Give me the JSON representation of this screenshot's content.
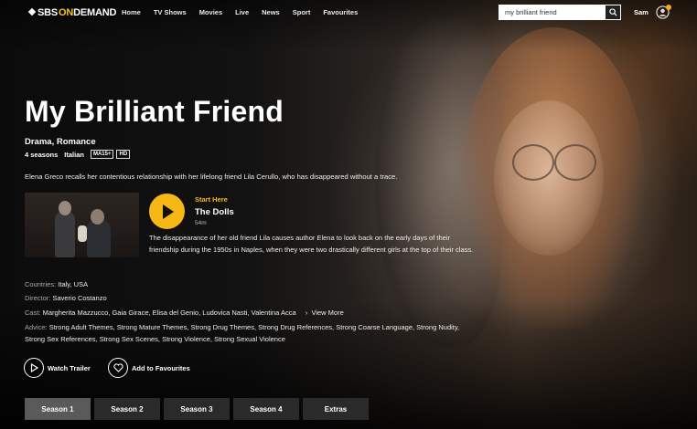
{
  "nav": {
    "logo": {
      "sbs": "SBS",
      "on": "ON",
      "demand": "DEMAND"
    },
    "links": [
      "Home",
      "TV Shows",
      "Movies",
      "Live",
      "News",
      "Sport",
      "Favourites"
    ],
    "search": {
      "value": "my brilliant friend",
      "icon": "search-icon"
    },
    "user": {
      "name": "Sam",
      "icon": "user-avatar-icon",
      "notification_color": "#f5a623"
    }
  },
  "show": {
    "title": "My Brilliant Friend",
    "genres": "Drama, Romance",
    "seasons": "4 seasons",
    "language": "Italian",
    "rating_badge": "MA15+",
    "quality_badge": "HD",
    "synopsis": "Elena Greco recalls her contentious relationship with her lifelong friend Lila Cerullo, who has disappeared without a trace."
  },
  "episode": {
    "start_label": "Start Here",
    "title": "The Dolls",
    "duration": "54m",
    "description": "The disappearance of her old friend Lila causes author Elena to look back on the early days of their friendship during the 1950s in Naples, when they were two drastically different girls at the top of their class.",
    "accent": "#f5b816"
  },
  "details": {
    "countries_label": "Countries:",
    "countries": "Italy, USA",
    "director_label": "Director:",
    "director": "Saverio Costanzo",
    "cast_label": "Cast:",
    "cast": "Margherita Mazzucco, Gaia Girace, Elisa del Genio, Ludovica Nasti, Valentina Acca",
    "view_more": "View More",
    "advice_label": "Advice:",
    "advice": "Strong Adult Themes, Strong Mature Themes, Strong Drug Themes, Strong Drug References, Strong Coarse Language, Strong Nudity, Strong Sex References, Strong Sex Scenes, Strong Violence, Strong Sexual Violence"
  },
  "actions": {
    "watch_trailer": "Watch Trailer",
    "add_favourites": "Add to Favourites"
  },
  "tabs": [
    "Season 1",
    "Season 2",
    "Season 3",
    "Season 4",
    "Extras"
  ],
  "active_tab": "Season 1"
}
